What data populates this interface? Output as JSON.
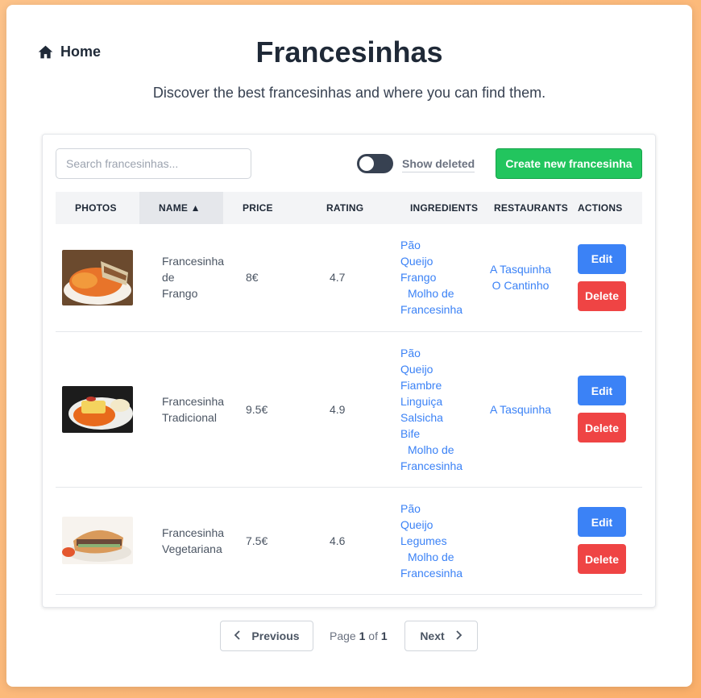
{
  "nav": {
    "home_label": "Home"
  },
  "header": {
    "title": "Francesinhas",
    "subtitle": "Discover the best francesinhas and where you can find them."
  },
  "toolbar": {
    "search_placeholder": "Search francesinhas...",
    "show_deleted_label": "Show deleted",
    "show_deleted_on": false,
    "create_label": "Create new francesinha"
  },
  "table": {
    "columns": [
      "PHOTOS",
      "NAME ▲",
      "PRICE",
      "RATING",
      "INGREDIENTS",
      "RESTAURANTS",
      "ACTIONS"
    ],
    "sorted_column": "NAME",
    "rows": [
      {
        "name_lines": [
          "Francesinha",
          "de",
          "Frango"
        ],
        "price": "8€",
        "rating": "4.7",
        "ingredients": [
          "Pão",
          "Queijo",
          "Frango",
          "Molho de Francesinha"
        ],
        "restaurants": [
          "A Tasquinha",
          "O Cantinho"
        ],
        "edit_label": "Edit",
        "delete_label": "Delete"
      },
      {
        "name_lines": [
          "Francesinha",
          "Tradicional"
        ],
        "price": "9.5€",
        "rating": "4.9",
        "ingredients": [
          "Pão",
          "Queijo",
          "Fiambre",
          "Linguiça",
          "Salsicha",
          "Bife",
          "Molho de Francesinha"
        ],
        "restaurants": [
          "A Tasquinha"
        ],
        "edit_label": "Edit",
        "delete_label": "Delete"
      },
      {
        "name_lines": [
          "Francesinha",
          "Vegetariana"
        ],
        "price": "7.5€",
        "rating": "4.6",
        "ingredients": [
          "Pão",
          "Queijo",
          "Legumes",
          "Molho de Francesinha"
        ],
        "restaurants": [],
        "edit_label": "Edit",
        "delete_label": "Delete"
      }
    ]
  },
  "pagination": {
    "previous_label": "Previous",
    "next_label": "Next",
    "page_word": "Page",
    "current": "1",
    "of_word": "of",
    "total": "1"
  },
  "colors": {
    "accent_blue": "#3b82f6",
    "create_green": "#22c55e",
    "delete_red": "#ef4444",
    "background_orange": "#fbb06b"
  }
}
